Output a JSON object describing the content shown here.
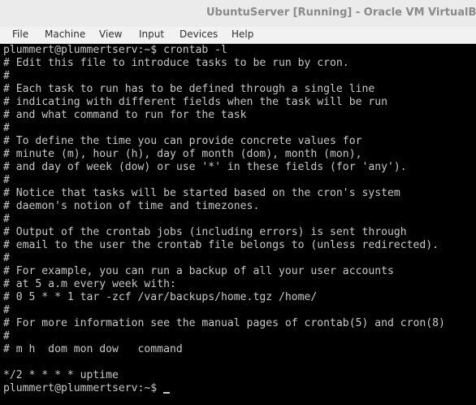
{
  "window": {
    "title": "UbuntuServer [Running] - Oracle VM VirtualBox"
  },
  "menu": [
    "File",
    "Machine",
    "View",
    "Input",
    "Devices",
    "Help"
  ],
  "terminal": {
    "lines": [
      "plummert@plummertserv:~$ crontab -l",
      "# Edit this file to introduce tasks to be run by cron.",
      "#",
      "# Each task to run has to be defined through a single line",
      "# indicating with different fields when the task will be run",
      "# and what command to run for the task",
      "#",
      "# To define the time you can provide concrete values for",
      "# minute (m), hour (h), day of month (dom), month (mon),",
      "# and day of week (dow) or use '*' in these fields (for 'any').",
      "#",
      "# Notice that tasks will be started based on the cron's system",
      "# daemon's notion of time and timezones.",
      "#",
      "# Output of the crontab jobs (including errors) is sent through",
      "# email to the user the crontab file belongs to (unless redirected).",
      "#",
      "# For example, you can run a backup of all your user accounts",
      "# at 5 a.m every week with:",
      "# 0 5 * * 1 tar -zcf /var/backups/home.tgz /home/",
      "#",
      "# For more information see the manual pages of crontab(5) and cron(8)",
      "#",
      "# m h  dom mon dow   command",
      "",
      "*/2 * * * * uptime",
      "plummert@plummertserv:~$ "
    ]
  }
}
